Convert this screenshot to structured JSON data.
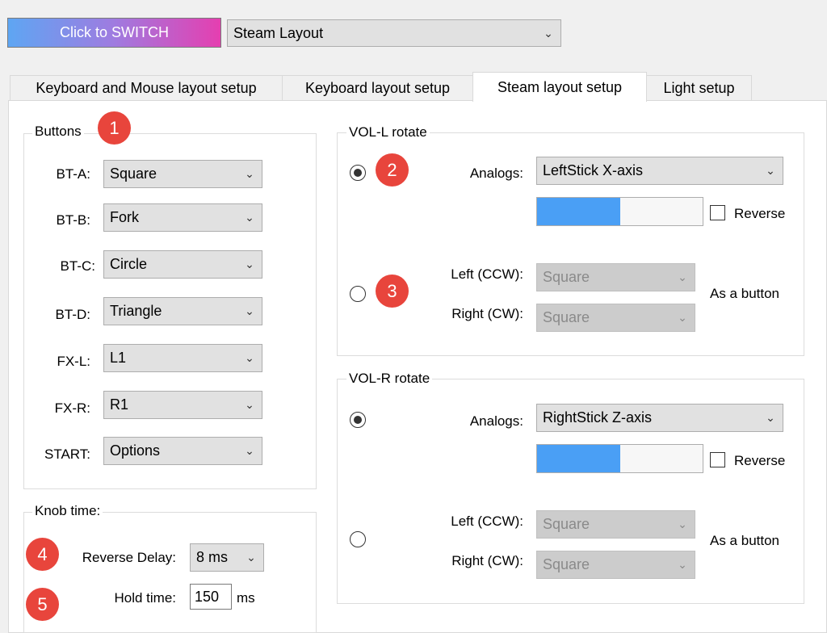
{
  "top": {
    "switch_label": "Click to SWITCH",
    "layout_select": "Steam Layout"
  },
  "tabs": [
    {
      "label": "Keyboard and Mouse layout setup",
      "active": false
    },
    {
      "label": "Keyboard layout setup",
      "active": false
    },
    {
      "label": "Steam layout setup",
      "active": true
    },
    {
      "label": "Light setup",
      "active": false
    }
  ],
  "buttons_group": {
    "title": "Buttons",
    "rows": [
      {
        "label": "BT-A:",
        "value": "Square"
      },
      {
        "label": "BT-B:",
        "value": "Fork"
      },
      {
        "label": "BT-C:",
        "value": "Circle"
      },
      {
        "label": "BT-D:",
        "value": "Triangle"
      },
      {
        "label": "FX-L:",
        "value": "L1"
      },
      {
        "label": "FX-R:",
        "value": "R1"
      },
      {
        "label": "START:",
        "value": "Options"
      }
    ]
  },
  "knob_group": {
    "title": "Knob time:",
    "reverse_delay_label": "Reverse Delay:",
    "reverse_delay_value": "8 ms",
    "hold_time_label": "Hold time:",
    "hold_time_value": "150",
    "hold_time_unit": "ms"
  },
  "vol_l": {
    "title": "VOL-L rotate",
    "mode": "analog",
    "analogs_label": "Analogs:",
    "analogs_value": "LeftStick X-axis",
    "level": 0.5,
    "reverse_label": "Reverse",
    "reverse_checked": false,
    "left_label": "Left (CCW):",
    "left_value": "Square",
    "right_label": "Right (CW):",
    "right_value": "Square",
    "as_button_label": "As a button"
  },
  "vol_r": {
    "title": "VOL-R rotate",
    "mode": "analog",
    "analogs_label": "Analogs:",
    "analogs_value": "RightStick Z-axis",
    "level": 0.5,
    "reverse_label": "Reverse",
    "reverse_checked": false,
    "left_label": "Left (CCW):",
    "left_value": "Square",
    "right_label": "Right (CW):",
    "right_value": "Square",
    "as_button_label": "As a button"
  },
  "badges": [
    "1",
    "2",
    "3",
    "4",
    "5"
  ],
  "colors": {
    "badge": "#e8453c",
    "slider_fill": "#4a9ff5",
    "switch_gradient_start": "#5ea6f3",
    "switch_gradient_end": "#e53fb0"
  }
}
